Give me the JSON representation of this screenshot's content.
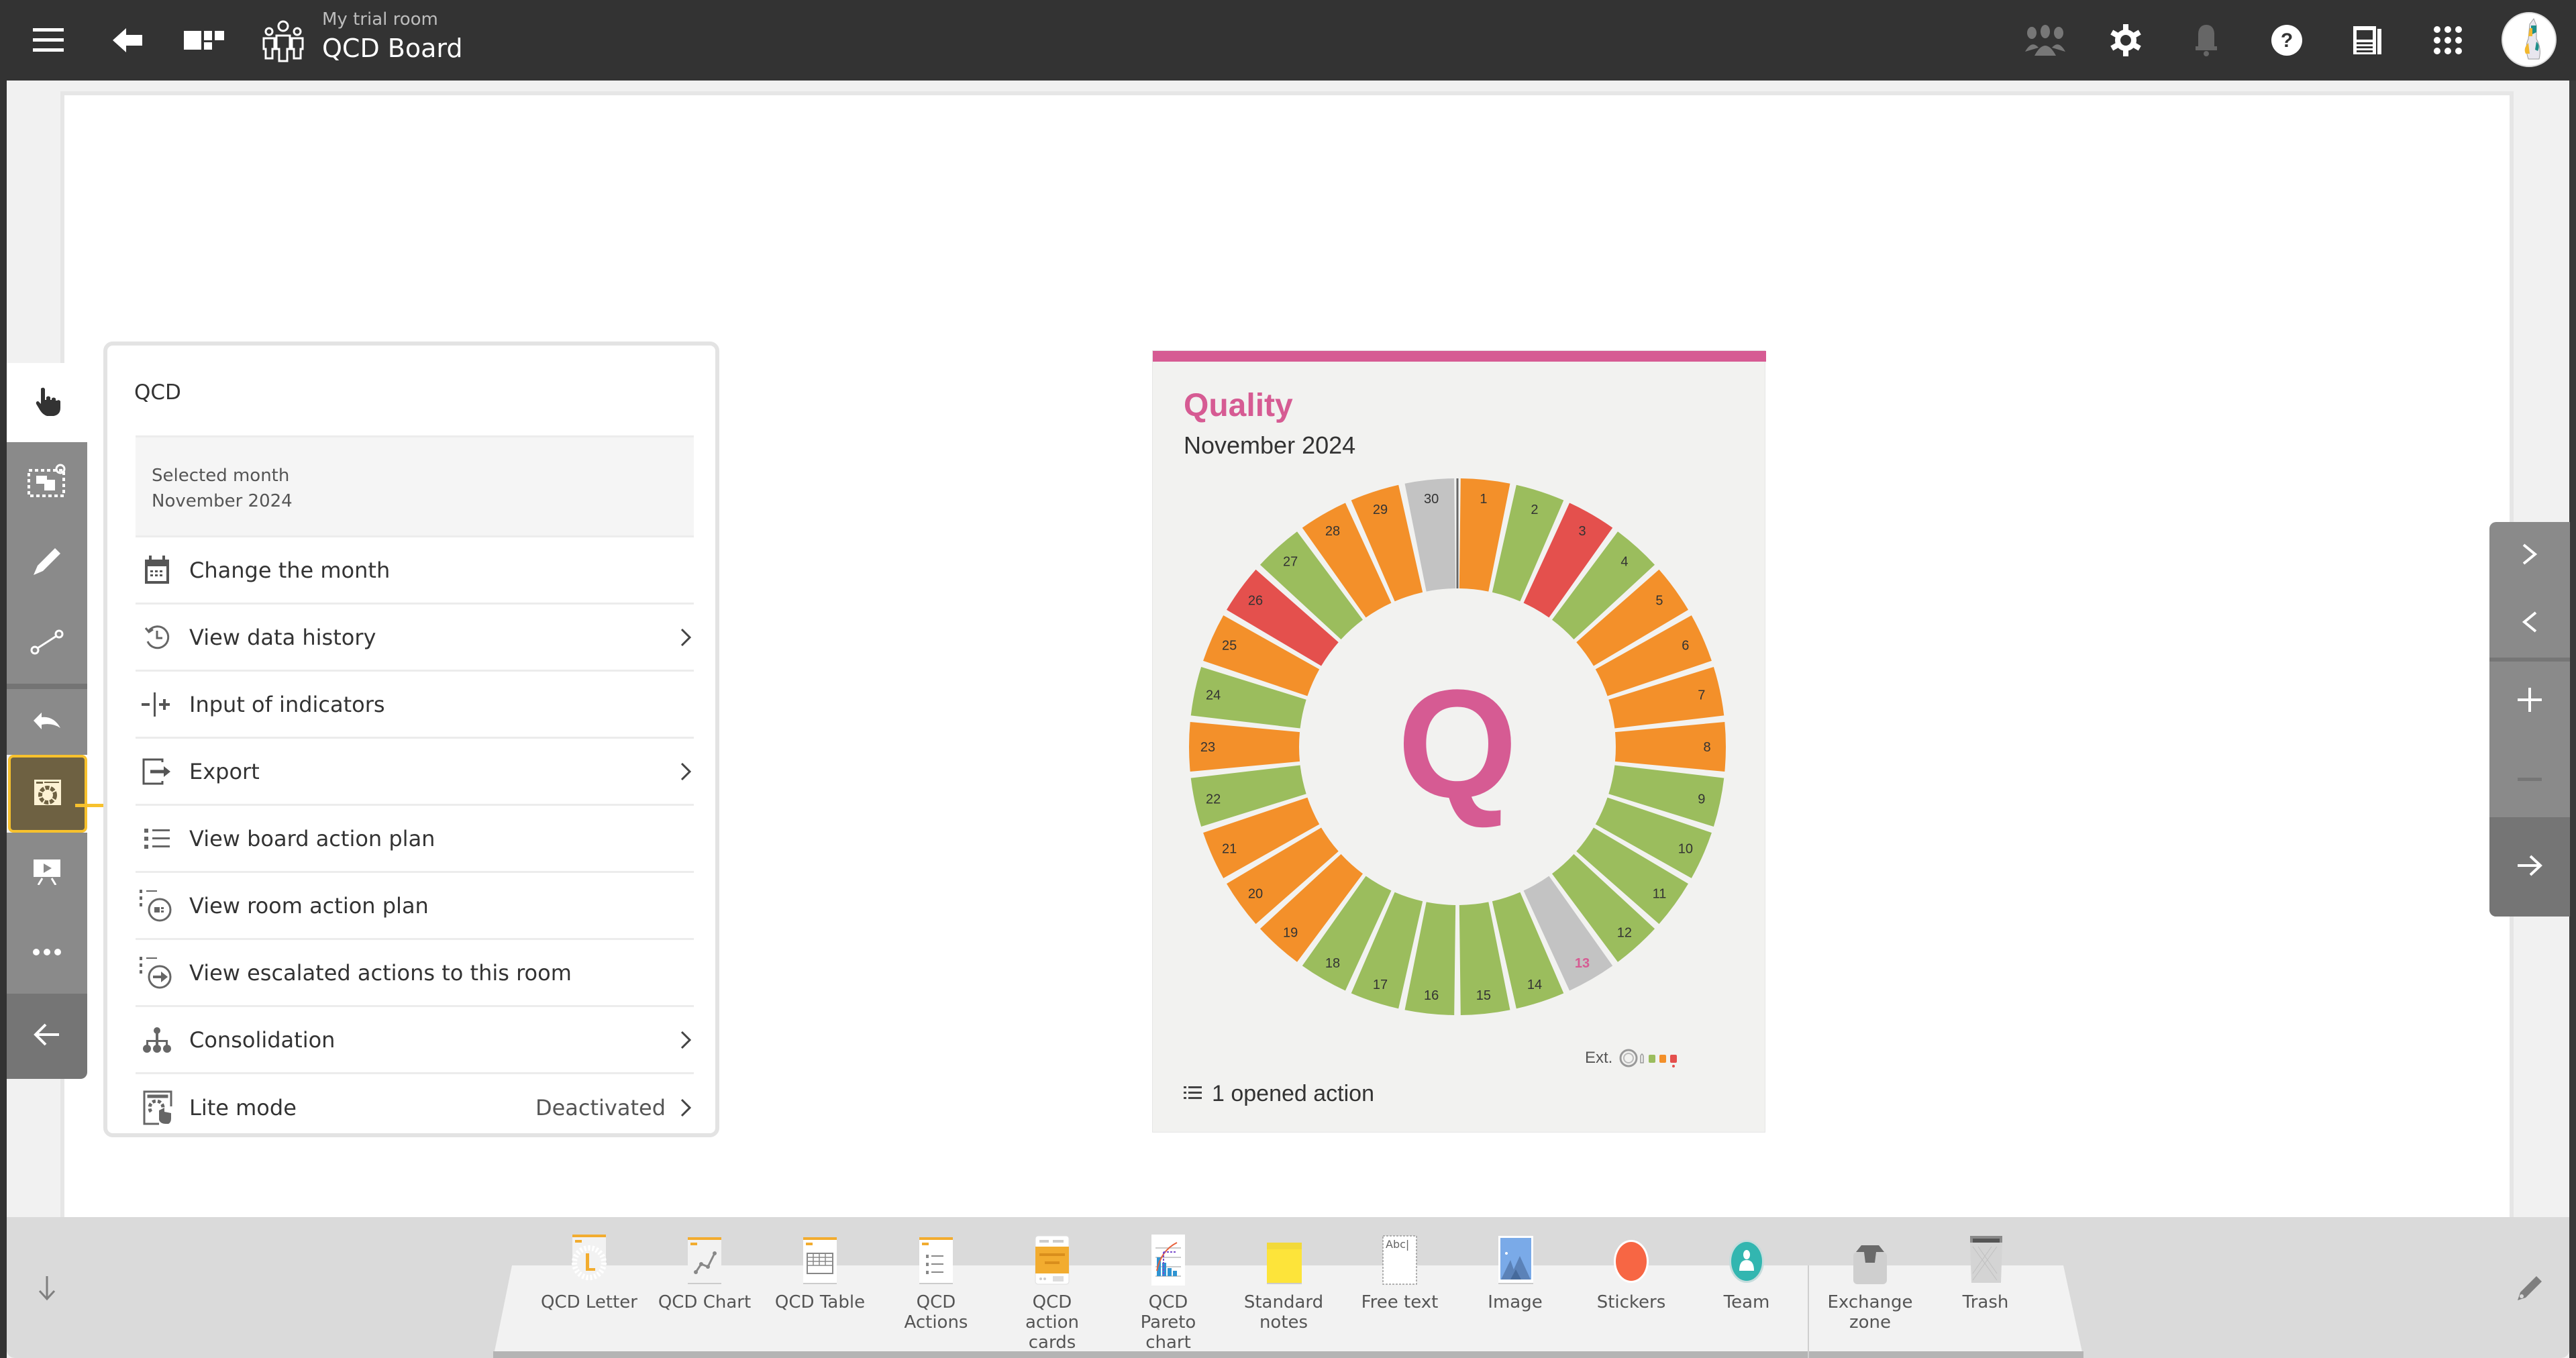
{
  "header": {
    "room_name": "My trial room",
    "board_name": "QCD Board",
    "icons": [
      "menu-icon",
      "back-arrow-icon",
      "board-layout-icon",
      "room-team-icon",
      "participants-icon",
      "settings-icon",
      "notifications-icon",
      "help-icon",
      "news-icon",
      "apps-grid-icon",
      "user-avatar"
    ]
  },
  "left_toolbar": {
    "tools": [
      {
        "name": "pointer",
        "icon": "hand-pointer-icon",
        "state": "active"
      },
      {
        "name": "select",
        "icon": "select-area-icon"
      },
      {
        "name": "draw",
        "icon": "pen-icon"
      },
      {
        "name": "connector",
        "icon": "connector-icon"
      },
      {
        "name": "undo",
        "icon": "undo-icon"
      },
      {
        "name": "qcd",
        "icon": "qcd-widget-icon",
        "state": "selected"
      },
      {
        "name": "presentation",
        "icon": "presentation-icon"
      },
      {
        "name": "more",
        "icon": "more-icon"
      },
      {
        "name": "collapse",
        "icon": "arrow-left-icon"
      }
    ]
  },
  "menu": {
    "title": "QCD",
    "selected_month_label": "Selected month",
    "selected_month_value": "November 2024",
    "items": [
      {
        "label": "Change the month",
        "icon": "calendar-icon",
        "has_submenu": false
      },
      {
        "label": "View data history",
        "icon": "history-icon",
        "has_submenu": true
      },
      {
        "label": "Input of indicators",
        "icon": "input-indicators-icon",
        "has_submenu": false
      },
      {
        "label": "Export",
        "icon": "export-icon",
        "has_submenu": true
      },
      {
        "label": "View board action plan",
        "icon": "action-list-icon",
        "has_submenu": false
      },
      {
        "label": "View room action plan",
        "icon": "room-action-plan-icon",
        "has_submenu": false
      },
      {
        "label": "View escalated actions to this room",
        "icon": "escalated-actions-icon",
        "has_submenu": false
      },
      {
        "label": "Consolidation",
        "icon": "hierarchy-icon",
        "has_submenu": true
      },
      {
        "label": "Lite mode",
        "icon": "lite-mode-icon",
        "has_submenu": true,
        "value": "Deactivated"
      }
    ]
  },
  "card": {
    "title": "Quality",
    "subtitle": "November 2024",
    "letter": "Q",
    "legend_label": "Ext.",
    "actions_text": "1 opened action",
    "colors": {
      "accent": "#d65b93",
      "green": "#9bbd5d",
      "orange": "#f3902a",
      "red": "#e4504d",
      "grey": "#c3c3c3"
    }
  },
  "chart_data": {
    "type": "pie",
    "title": "Quality",
    "subtitle": "November 2024",
    "categories": [
      "1",
      "2",
      "3",
      "4",
      "5",
      "6",
      "7",
      "8",
      "9",
      "10",
      "11",
      "12",
      "13",
      "14",
      "15",
      "16",
      "17",
      "18",
      "19",
      "20",
      "21",
      "22",
      "23",
      "24",
      "25",
      "26",
      "27",
      "28",
      "29",
      "30"
    ],
    "status": [
      "orange",
      "green",
      "red",
      "green",
      "orange",
      "orange",
      "orange",
      "orange",
      "green",
      "green",
      "green",
      "green",
      "none",
      "green",
      "green",
      "green",
      "green",
      "green",
      "orange",
      "orange",
      "orange",
      "green",
      "orange",
      "green",
      "orange",
      "red",
      "green",
      "orange",
      "orange",
      "none"
    ],
    "highlighted_day": "13",
    "center_label": "Q",
    "legend": [
      "neutral",
      "manual",
      "green",
      "orange",
      "red"
    ]
  },
  "right_nav": {
    "buttons": [
      {
        "name": "next",
        "icon": "chevron-right-icon"
      },
      {
        "name": "previous",
        "icon": "chevron-left-icon"
      },
      {
        "name": "zoom-in",
        "icon": "plus-icon"
      },
      {
        "name": "zoom-out",
        "icon": "minus-icon",
        "disabled": true
      },
      {
        "name": "go",
        "icon": "arrow-right-icon"
      }
    ]
  },
  "dock": {
    "items": [
      {
        "label": "QCD Letter",
        "icon": "qcd-letter-icon"
      },
      {
        "label": "QCD Chart",
        "icon": "qcd-chart-icon"
      },
      {
        "label": "QCD Table",
        "icon": "qcd-table-icon"
      },
      {
        "label": "QCD Actions",
        "icon": "qcd-actions-icon"
      },
      {
        "label": "QCD action cards",
        "icon": "qcd-action-cards-icon"
      },
      {
        "label": "QCD Pareto chart",
        "icon": "qcd-pareto-icon"
      },
      {
        "label": "Standard notes",
        "icon": "sticky-note-icon"
      },
      {
        "label": "Free text",
        "icon": "free-text-icon"
      },
      {
        "label": "Image",
        "icon": "image-icon"
      },
      {
        "label": "Stickers",
        "icon": "stickers-icon"
      },
      {
        "label": "Team",
        "icon": "team-icon"
      },
      {
        "label": "Exchange zone",
        "icon": "exchange-zone-icon"
      },
      {
        "label": "Trash",
        "icon": "trash-icon"
      }
    ],
    "free_text_sample": "Abc|"
  }
}
